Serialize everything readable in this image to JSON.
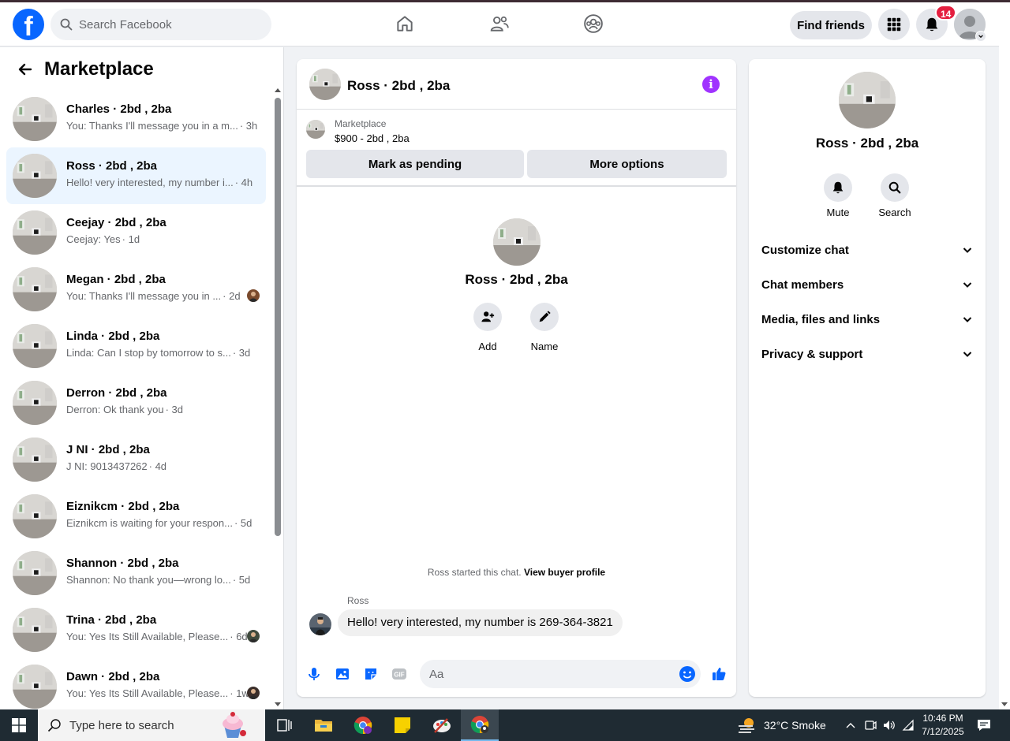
{
  "colors": {
    "brand": "#0866ff",
    "accent_purple": "#a033ff",
    "badge_red": "#e41e3f",
    "active_row": "#ebf5ff"
  },
  "header": {
    "logo_letter": "f",
    "search_placeholder": "Search Facebook",
    "nav_icons": [
      "home-icon",
      "friends-icon",
      "groups-icon"
    ],
    "find_friends_label": "Find friends",
    "notification_count": "14"
  },
  "sidebar": {
    "title": "Marketplace",
    "conversations": [
      {
        "title": "Charles · 2bd , 2ba",
        "message": "You: Thanks I'll message you in a m...",
        "time": "· 3h",
        "active": false,
        "mini_avatar": false
      },
      {
        "title": "Ross · 2bd , 2ba",
        "message": "Hello! very interested, my number i...",
        "time": "· 4h",
        "active": true,
        "mini_avatar": false
      },
      {
        "title": "Ceejay · 2bd , 2ba",
        "message": "Ceejay: Yes",
        "time": "· 1d",
        "active": false,
        "mini_avatar": false
      },
      {
        "title": "Megan · 2bd , 2ba",
        "message": "You: Thanks I'll message you in ...",
        "time": "· 2d",
        "active": false,
        "mini_avatar": true
      },
      {
        "title": "Linda · 2bd , 2ba",
        "message": "Linda: Can I stop by tomorrow to s...",
        "time": "· 3d",
        "active": false,
        "mini_avatar": false
      },
      {
        "title": "Derron · 2bd , 2ba",
        "message": "Derron: Ok thank you",
        "time": "· 3d",
        "active": false,
        "mini_avatar": false
      },
      {
        "title": "J NI · 2bd , 2ba",
        "message": "J NI: 9013437262",
        "time": "· 4d",
        "active": false,
        "mini_avatar": false
      },
      {
        "title": "Eiznikcm · 2bd , 2ba",
        "message": "Eiznikcm is waiting for your respon...",
        "time": "· 5d",
        "active": false,
        "mini_avatar": false
      },
      {
        "title": "Shannon · 2bd , 2ba",
        "message": "Shannon: No thank you—wrong lo...",
        "time": "· 5d",
        "active": false,
        "mini_avatar": false
      },
      {
        "title": "Trina · 2bd , 2ba",
        "message": "You: Yes Its Still Available, Please...",
        "time": "· 6d",
        "active": false,
        "mini_avatar": true
      },
      {
        "title": "Dawn · 2bd , 2ba",
        "message": "You: Yes Its Still Available, Please...",
        "time": "· 1w",
        "active": false,
        "mini_avatar": true
      }
    ]
  },
  "chat": {
    "title": "Ross · 2bd , 2ba",
    "info_glyph": "i",
    "listing_label": "Marketplace",
    "listing_price": "$900 - 2bd , 2ba",
    "mark_pending_label": "Mark as pending",
    "more_options_label": "More options",
    "center_name": "Ross · 2bd , 2ba",
    "add_label": "Add",
    "name_label": "Name",
    "started_text": "Ross started this chat.",
    "view_profile_link": "View buyer profile",
    "sender_name": "Ross",
    "message_text": "Hello! very interested, my number is 269-364-3821",
    "input_placeholder": "Aa",
    "gif_label": "GIF"
  },
  "details": {
    "name": "Ross · 2bd , 2ba",
    "mute_label": "Mute",
    "search_label": "Search",
    "sections": [
      "Customize chat",
      "Chat members",
      "Media, files and links",
      "Privacy & support"
    ]
  },
  "taskbar": {
    "search_placeholder": "Type here to search",
    "weather": "32°C  Smoke",
    "time": "10:46 PM",
    "date": "7/12/2025"
  }
}
